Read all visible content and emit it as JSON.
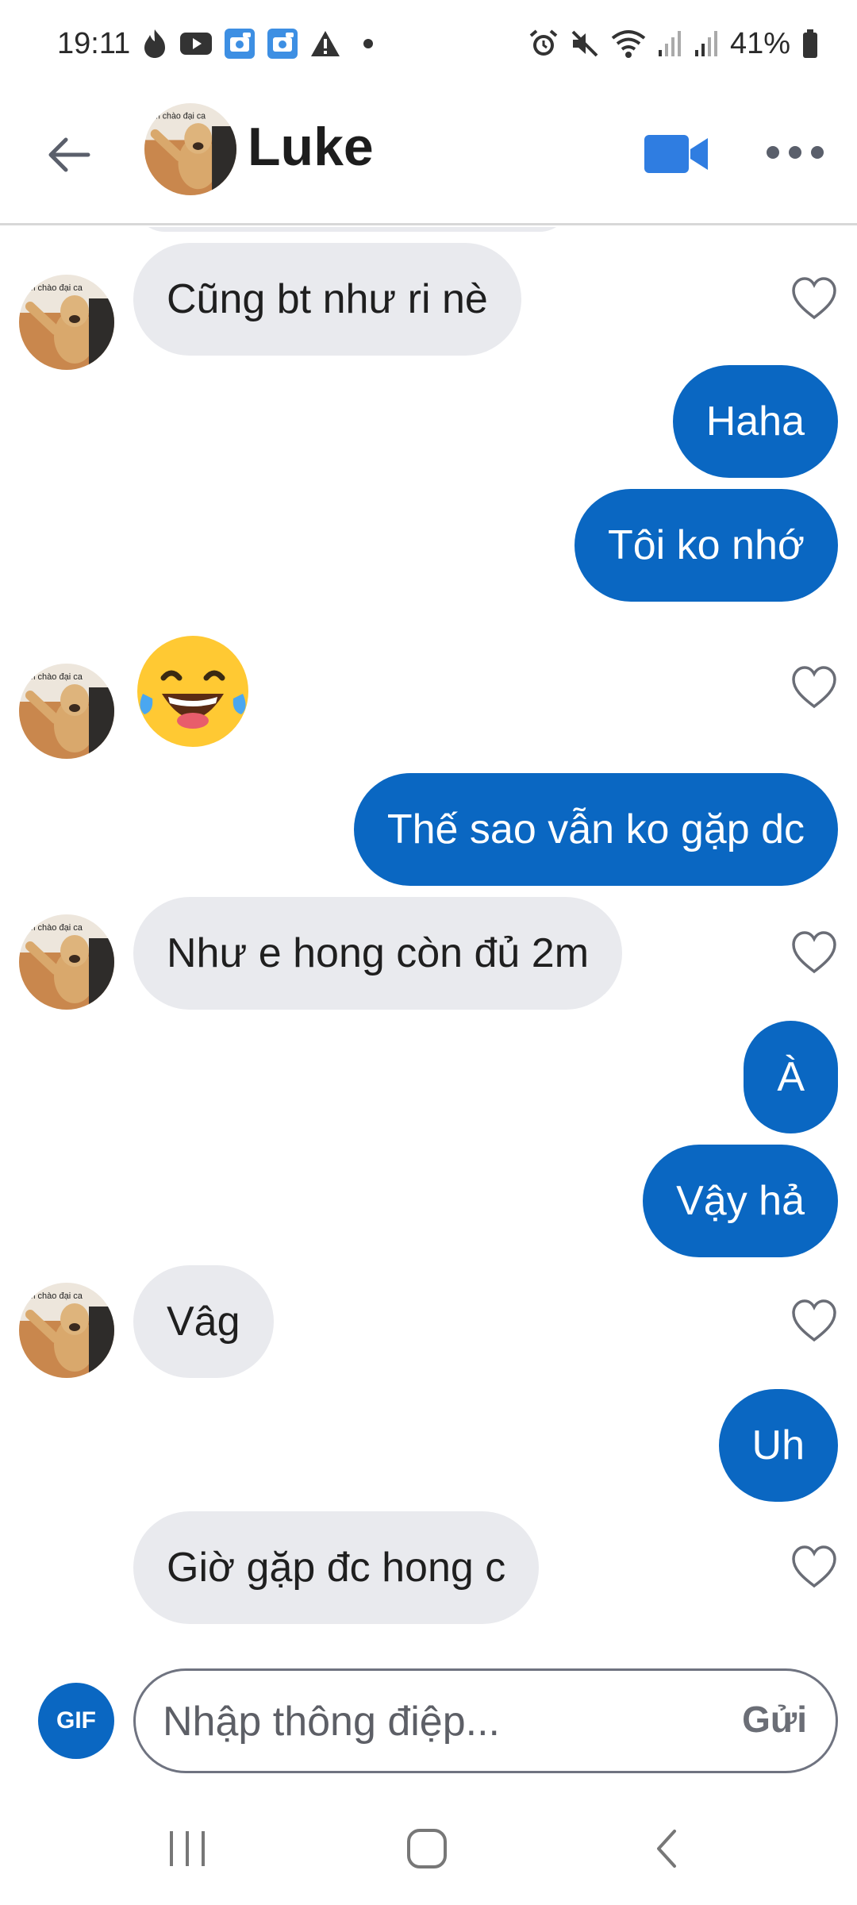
{
  "status_bar": {
    "time": "19:11",
    "battery": "41%",
    "left_icons": [
      "tinder-flame-icon",
      "youtube-icon",
      "photo-app-icon",
      "photo-app-icon",
      "warning-icon"
    ],
    "right_icons": [
      "alarm-icon",
      "mute-icon",
      "wifi-icon",
      "signal-icon",
      "signal-icon",
      "battery-icon"
    ]
  },
  "header": {
    "name": "Luke",
    "avatar_caption": "Em chào đại ca",
    "video_icon": "video-camera-icon",
    "more_icon": "more-dots-icon",
    "back_icon": "back-arrow-icon"
  },
  "messages": [
    {
      "from": "them",
      "text": "Cũng bt như ri nè",
      "avatar": true,
      "heart": true
    },
    {
      "from": "me",
      "text": "Haha"
    },
    {
      "from": "me",
      "text": "Tôi ko nhớ"
    },
    {
      "from": "them",
      "emoji": "😂",
      "avatar": true,
      "heart": true
    },
    {
      "from": "me",
      "text": "Thế sao vẫn ko gặp dc"
    },
    {
      "from": "them",
      "text": "Như e hong còn đủ 2m",
      "avatar": true,
      "heart": true
    },
    {
      "from": "me",
      "text": "À"
    },
    {
      "from": "me",
      "text": "Vậy hả"
    },
    {
      "from": "them",
      "text": "Vâg",
      "avatar": true,
      "heart": true
    },
    {
      "from": "me",
      "text": "Uh"
    },
    {
      "from": "them",
      "text": "Giờ gặp đc hong c",
      "avatar": false,
      "heart": true
    }
  ],
  "composer": {
    "gif_label": "GIF",
    "placeholder": "Nhập thông điệp...",
    "send_label": "Gửi"
  },
  "nav_bar": [
    "recent-apps-icon",
    "home-icon",
    "back-icon"
  ],
  "colors": {
    "accent": "#0a67c2",
    "incoming_bubble": "#e9eaee",
    "outgoing_text": "#ffffff"
  }
}
